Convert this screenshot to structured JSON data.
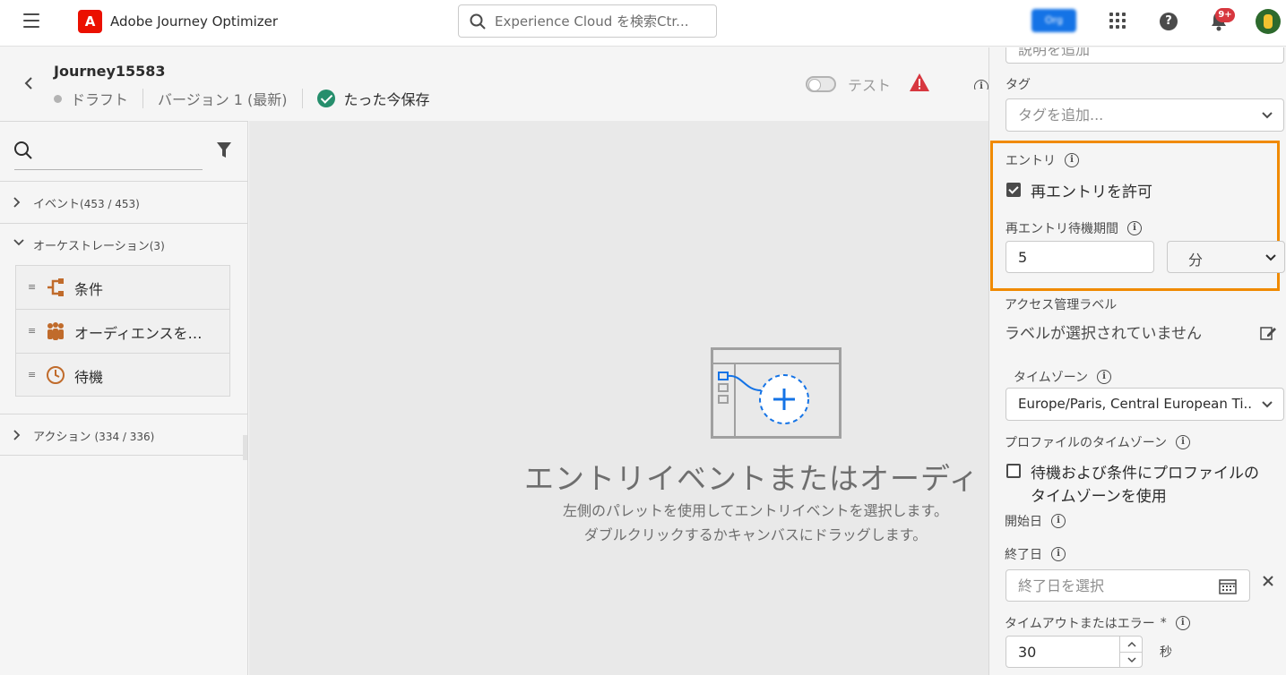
{
  "topnav": {
    "app_title": "Adobe Journey Optimizer",
    "logo_letter": "A",
    "search_placeholder": "Experience Cloud を検索Ctr...",
    "org_label": "Org",
    "notification_count": "9+"
  },
  "journey": {
    "name": "Journey15583",
    "status": "ドラフト",
    "version": "バージョン 1 (最新)",
    "saved": "たった今保存",
    "test_label": "テスト"
  },
  "palette": {
    "sections": [
      {
        "label": "イベント",
        "count": "(453 / 453)",
        "expanded": false
      },
      {
        "label": "オーケストレーション",
        "count": "(3)",
        "expanded": true
      },
      {
        "label": "アクション",
        "count": "(334 / 336)",
        "expanded": false
      }
    ],
    "items": [
      {
        "label": "条件",
        "icon": "condition-icon"
      },
      {
        "label": "オーディエンスを…",
        "icon": "audience-icon"
      },
      {
        "label": "待機",
        "icon": "clock-icon"
      }
    ]
  },
  "canvas": {
    "heading": "エントリイベントまたはオーディ",
    "sub1": "左側のパレットを使用してエントリイベントを選択します。",
    "sub2": "ダブルクリックするかキャンバスにドラッグします。"
  },
  "properties": {
    "description_placeholder": "説明を追加",
    "tags_label": "タグ",
    "tags_placeholder": "タグを追加...",
    "entry_label": "エントリ",
    "allow_reentry_label": "再エントリを許可",
    "allow_reentry_checked": true,
    "reentry_wait_label": "再エントリ待機期間",
    "reentry_wait_value": "5",
    "reentry_wait_unit": "分",
    "access_label": "アクセス管理ラベル",
    "access_value": "ラベルが選択されていません",
    "timezone_label": "タイムゾーン",
    "timezone_value": "Europe/Paris, Central European Ti...",
    "profile_tz_label": "プロファイルのタイムゾーン",
    "profile_tz_checkbox_line1": "待機および条件にプロファイルの",
    "profile_tz_checkbox_line2": "タイムゾーンを使用",
    "start_date_label": "開始日",
    "end_date_label": "終了日",
    "end_date_placeholder": "終了日を選択",
    "timeout_label": "タイムアウトまたはエラー",
    "timeout_required": "*",
    "timeout_value": "30",
    "timeout_unit": "秒"
  },
  "colors": {
    "highlight": "#f08a00",
    "saved_green": "#268e6c",
    "warning_red": "#d7373f",
    "brand_red": "#eb1000",
    "accent_blue": "#1473e6"
  }
}
